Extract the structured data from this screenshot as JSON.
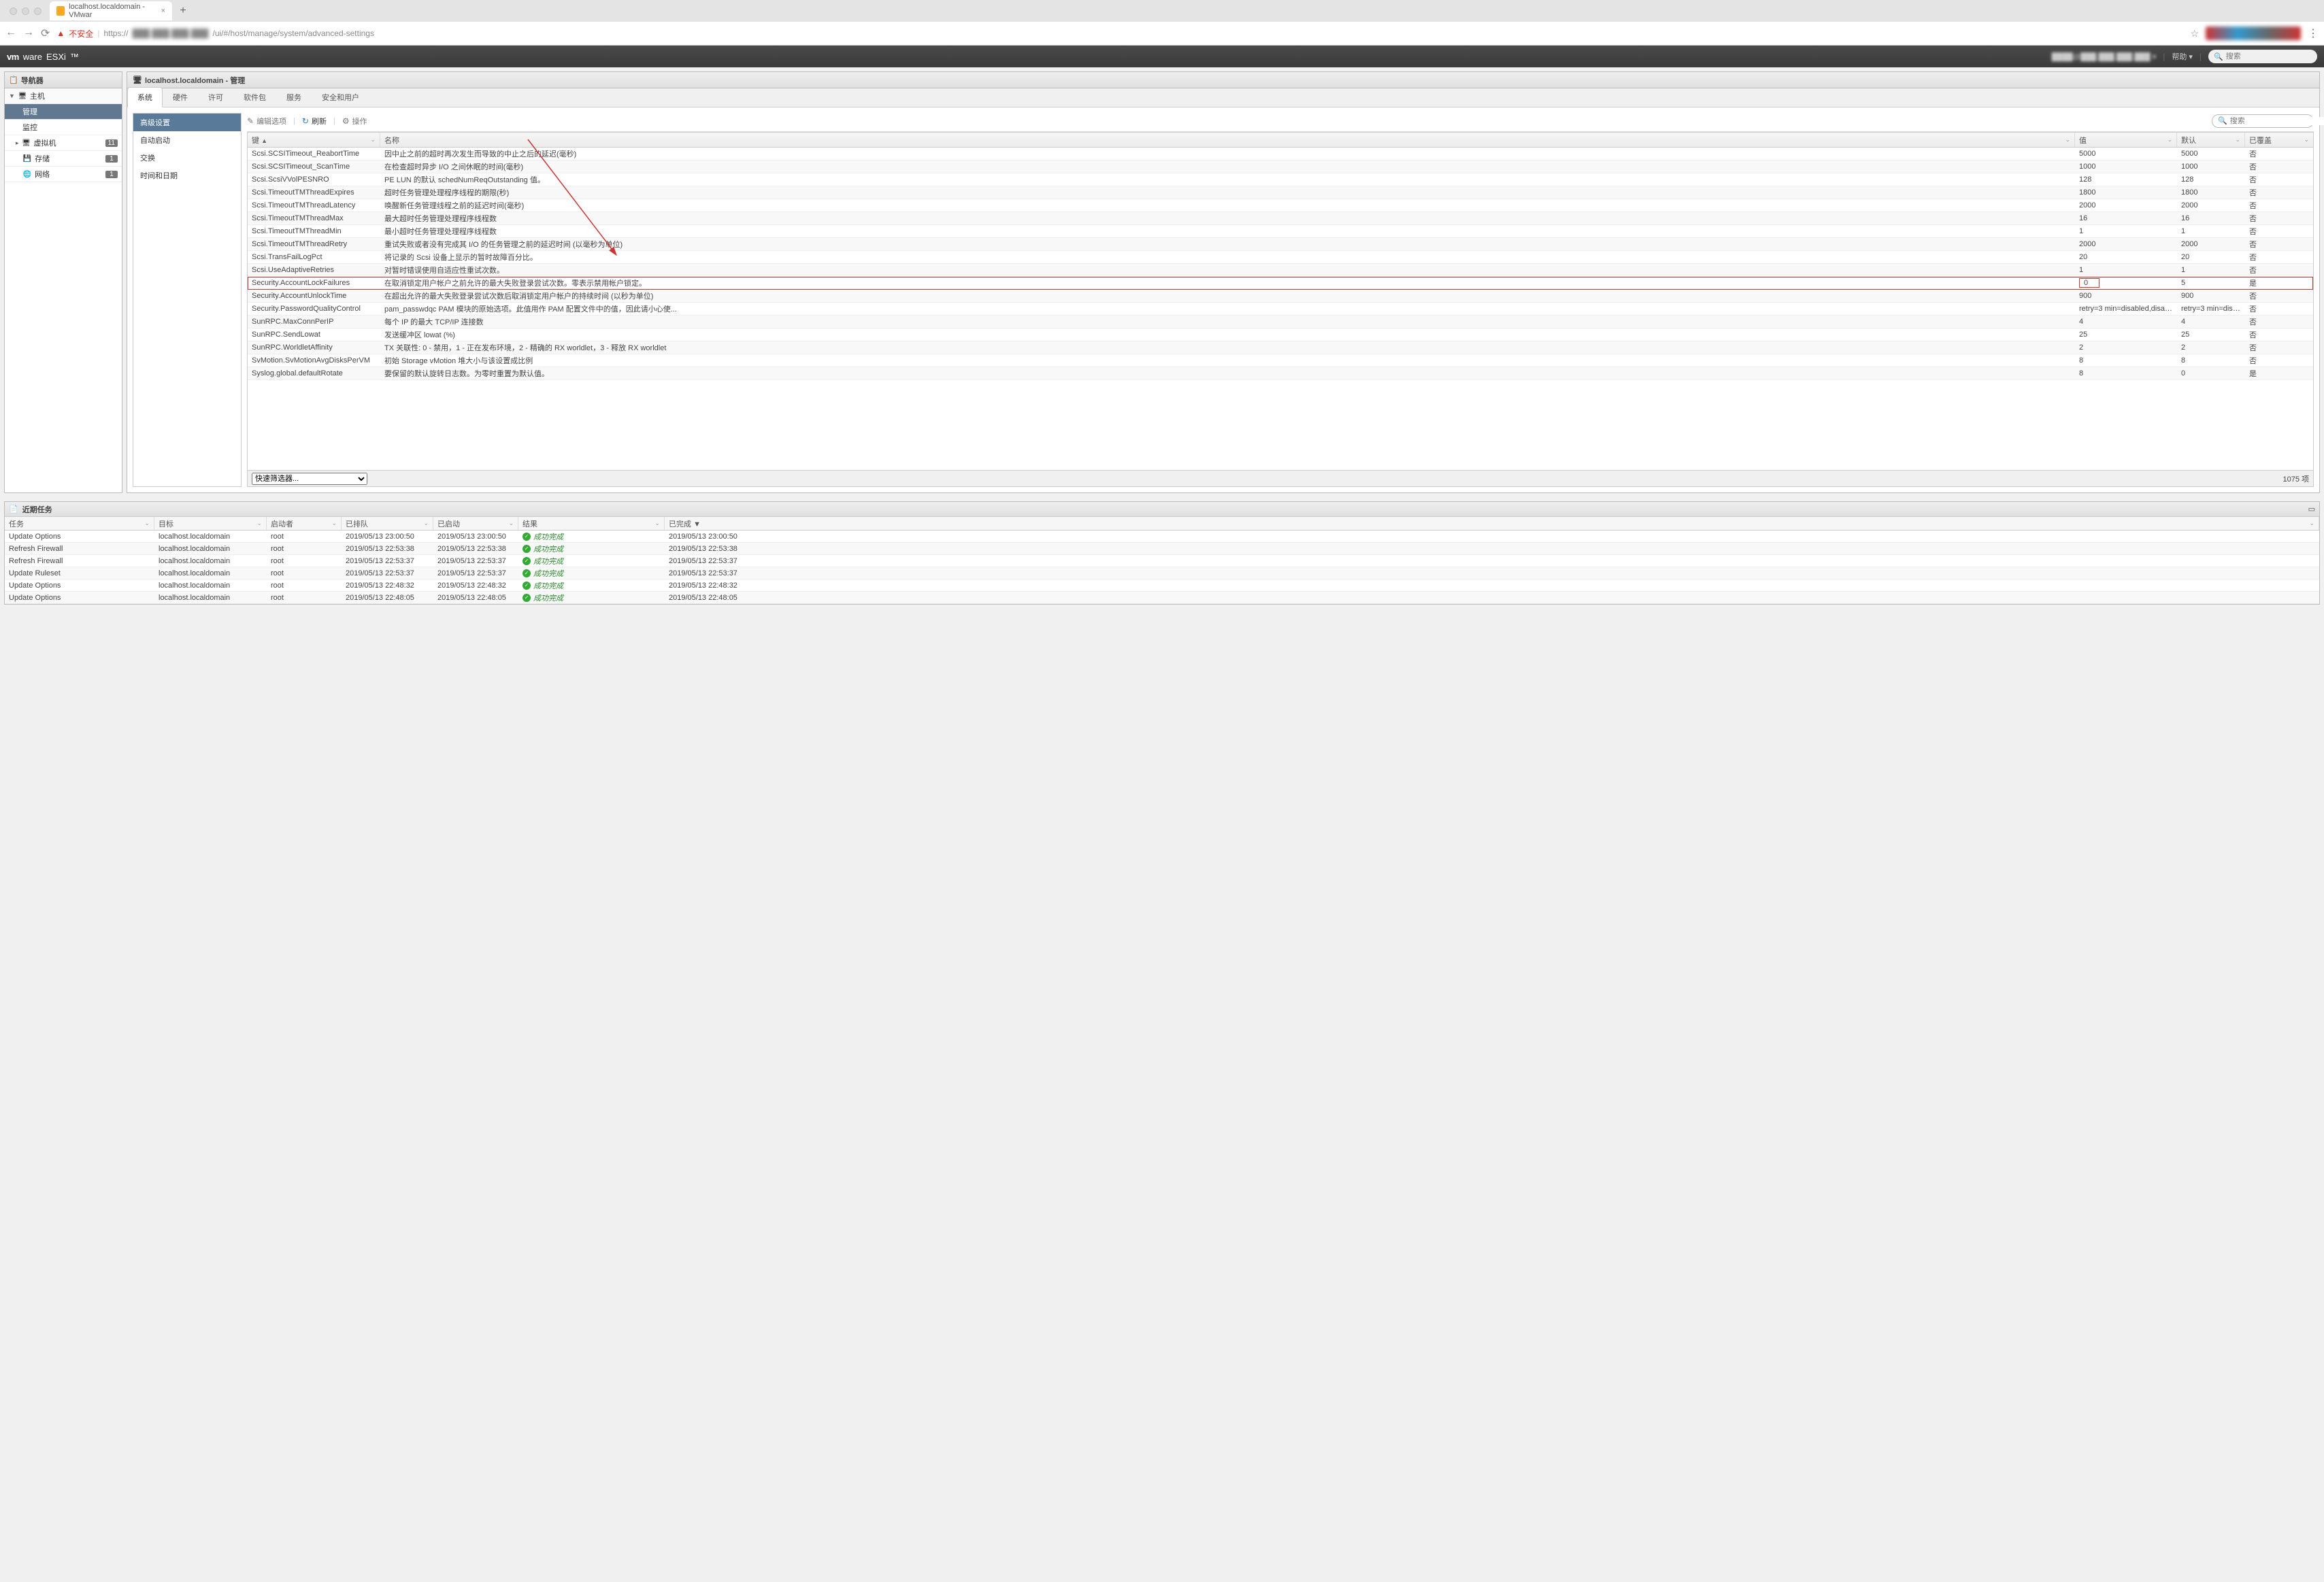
{
  "browser": {
    "tab_title": "localhost.localdomain - VMwar",
    "insecure_label": "不安全",
    "url_scheme": "https",
    "url_host": "███.███.███.███",
    "url_path": "/ui/#/host/manage/system/advanced-settings"
  },
  "header": {
    "product": "vmware ESXi",
    "help": "帮助",
    "search_placeholder": "搜索"
  },
  "navigator": {
    "title": "导航器",
    "host": "主机",
    "manage": "管理",
    "monitor": "监控",
    "vms": "虚拟机",
    "storage": "存储",
    "network": "网络",
    "vms_count": "11",
    "storage_count": "1",
    "network_count": "1"
  },
  "contentTitle": "localhost.localdomain - 管理",
  "tabs": [
    "系统",
    "硬件",
    "许可",
    "软件包",
    "服务",
    "安全和用户"
  ],
  "subnav": [
    "高级设置",
    "自动启动",
    "交换",
    "时间和日期"
  ],
  "toolbar": {
    "edit": "编辑选项",
    "refresh": "刷新",
    "actions": "操作",
    "search_placeholder": "搜索"
  },
  "grid": {
    "columns": {
      "key": "键",
      "name": "名称",
      "value": "值",
      "default": "默认",
      "override": "已覆盖"
    },
    "footer_filter": "快速筛选器...",
    "footer_count": "1075 项",
    "rows": [
      {
        "key": "Scsi.SCSITimeout_ReabortTime",
        "name": "因中止之前的超时再次发生而导致的中止之后的延迟(毫秒)",
        "value": "5000",
        "def": "5000",
        "over": "否"
      },
      {
        "key": "Scsi.SCSITimeout_ScanTime",
        "name": "在检查超时异步 I/O 之间休眠的时间(毫秒)",
        "value": "1000",
        "def": "1000",
        "over": "否"
      },
      {
        "key": "Scsi.ScsiVVolPESNRO",
        "name": "PE LUN 的默认 schedNumReqOutstanding 值。",
        "value": "128",
        "def": "128",
        "over": "否"
      },
      {
        "key": "Scsi.TimeoutTMThreadExpires",
        "name": "超时任务管理处理程序线程的期限(秒)",
        "value": "1800",
        "def": "1800",
        "over": "否"
      },
      {
        "key": "Scsi.TimeoutTMThreadLatency",
        "name": "唤醒新任务管理线程之前的延迟时间(毫秒)",
        "value": "2000",
        "def": "2000",
        "over": "否"
      },
      {
        "key": "Scsi.TimeoutTMThreadMax",
        "name": "最大超时任务管理处理程序线程数",
        "value": "16",
        "def": "16",
        "over": "否"
      },
      {
        "key": "Scsi.TimeoutTMThreadMin",
        "name": "最小超时任务管理处理程序线程数",
        "value": "1",
        "def": "1",
        "over": "否"
      },
      {
        "key": "Scsi.TimeoutTMThreadRetry",
        "name": "重试失败或者没有完成其 I/O 的任务管理之前的延迟时间 (以毫秒为单位)",
        "value": "2000",
        "def": "2000",
        "over": "否"
      },
      {
        "key": "Scsi.TransFailLogPct",
        "name": "将记录的 Scsi 设备上显示的暂时故障百分比。",
        "value": "20",
        "def": "20",
        "over": "否"
      },
      {
        "key": "Scsi.UseAdaptiveRetries",
        "name": "对暂时错误使用自适应性重试次数。",
        "value": "1",
        "def": "1",
        "over": "否"
      },
      {
        "key": "Security.AccountLockFailures",
        "name": "在取消锁定用户帐户之前允许的最大失败登录尝试次数。零表示禁用帐户锁定。",
        "value": "0",
        "def": "5",
        "over": "是",
        "highlight": true
      },
      {
        "key": "Security.AccountUnlockTime",
        "name": "在超出允许的最大失败登录尝试次数后取消锁定用户帐户的持续时间 (以秒为单位)",
        "value": "900",
        "def": "900",
        "over": "否"
      },
      {
        "key": "Security.PasswordQualityControl",
        "name": "pam_passwdqc PAM 模块的原始选项。此值用作 PAM 配置文件中的值，因此请小心使...",
        "value": "retry=3 min=disabled,disabled,...",
        "def": "retry=3 min=disabl...",
        "over": "否"
      },
      {
        "key": "SunRPC.MaxConnPerIP",
        "name": "每个 IP 的最大 TCP/IP 连接数",
        "value": "4",
        "def": "4",
        "over": "否"
      },
      {
        "key": "SunRPC.SendLowat",
        "name": "发送缓冲区 lowat (%)",
        "value": "25",
        "def": "25",
        "over": "否"
      },
      {
        "key": "SunRPC.WorldletAffinity",
        "name": "TX 关联性: 0 - 禁用，1 - 正在发布环境，2 - 精确的 RX worldlet，3 - 释放 RX worldlet",
        "value": "2",
        "def": "2",
        "over": "否"
      },
      {
        "key": "SvMotion.SvMotionAvgDisksPerVM",
        "name": "初始 Storage vMotion 堆大小与该设置成比例",
        "value": "8",
        "def": "8",
        "over": "否"
      },
      {
        "key": "Syslog.global.defaultRotate",
        "name": "要保留的默认旋转日志数。为零时重置为默认值。",
        "value": "8",
        "def": "0",
        "over": "是"
      }
    ]
  },
  "tasks": {
    "title": "近期任务",
    "columns": {
      "task": "任务",
      "target": "目标",
      "initiator": "启动者",
      "queued": "已排队",
      "started": "已启动",
      "result": "结果",
      "completed": "已完成"
    },
    "sort_indicator": "▼",
    "rows": [
      {
        "task": "Update Options",
        "target": "localhost.localdomain",
        "init": "root",
        "queued": "2019/05/13 23:00:50",
        "started": "2019/05/13 23:00:50",
        "result": "成功完成",
        "completed": "2019/05/13 23:00:50"
      },
      {
        "task": "Refresh Firewall",
        "target": "localhost.localdomain",
        "init": "root",
        "queued": "2019/05/13 22:53:38",
        "started": "2019/05/13 22:53:38",
        "result": "成功完成",
        "completed": "2019/05/13 22:53:38"
      },
      {
        "task": "Refresh Firewall",
        "target": "localhost.localdomain",
        "init": "root",
        "queued": "2019/05/13 22:53:37",
        "started": "2019/05/13 22:53:37",
        "result": "成功完成",
        "completed": "2019/05/13 22:53:37"
      },
      {
        "task": "Update Ruleset",
        "target": "localhost.localdomain",
        "init": "root",
        "queued": "2019/05/13 22:53:37",
        "started": "2019/05/13 22:53:37",
        "result": "成功完成",
        "completed": "2019/05/13 22:53:37"
      },
      {
        "task": "Update Options",
        "target": "localhost.localdomain",
        "init": "root",
        "queued": "2019/05/13 22:48:32",
        "started": "2019/05/13 22:48:32",
        "result": "成功完成",
        "completed": "2019/05/13 22:48:32"
      },
      {
        "task": "Update Options",
        "target": "localhost.localdomain",
        "init": "root",
        "queued": "2019/05/13 22:48:05",
        "started": "2019/05/13 22:48:05",
        "result": "成功完成",
        "completed": "2019/05/13 22:48:05"
      }
    ]
  }
}
